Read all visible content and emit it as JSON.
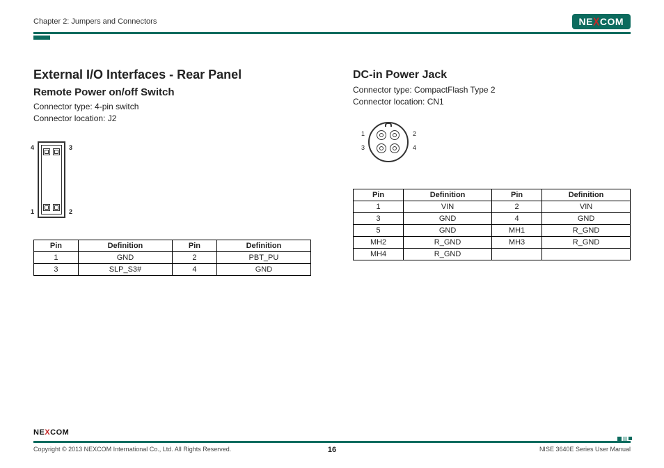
{
  "header": {
    "chapter": "Chapter 2: Jumpers and Connectors",
    "brand": {
      "pre": "NE",
      "x": "X",
      "post": "COM"
    }
  },
  "left": {
    "h1": "External I/O Interfaces - Rear Panel",
    "h2": "Remote Power on/off Switch",
    "meta1": "Connector type: 4-pin switch",
    "meta2": "Connector location: J2",
    "pins": {
      "p1": "1",
      "p2": "2",
      "p3": "3",
      "p4": "4"
    },
    "table": {
      "headers": [
        "Pin",
        "Definition",
        "Pin",
        "Definition"
      ],
      "rows": [
        [
          "1",
          "GND",
          "2",
          "PBT_PU"
        ],
        [
          "3",
          "SLP_S3#",
          "4",
          "GND"
        ]
      ]
    }
  },
  "right": {
    "h2": "DC-in Power Jack",
    "meta1": "Connector type: CompactFlash Type 2",
    "meta2": "Connector location: CN1",
    "pins": {
      "p1": "1",
      "p2": "2",
      "p3": "3",
      "p4": "4"
    },
    "table": {
      "headers": [
        "Pin",
        "Definition",
        "Pin",
        "Definition"
      ],
      "rows": [
        [
          "1",
          "VIN",
          "2",
          "VIN"
        ],
        [
          "3",
          "GND",
          "4",
          "GND"
        ],
        [
          "5",
          "GND",
          "MH1",
          "R_GND"
        ],
        [
          "MH2",
          "R_GND",
          "MH3",
          "R_GND"
        ],
        [
          "MH4",
          "R_GND",
          "",
          ""
        ]
      ]
    }
  },
  "footer": {
    "brand": {
      "pre": "NE",
      "x": "X",
      "post": "COM"
    },
    "copyright": "Copyright © 2013 NEXCOM International Co., Ltd. All Rights Reserved.",
    "page": "16",
    "manual": "NISE 3640E Series User Manual"
  }
}
